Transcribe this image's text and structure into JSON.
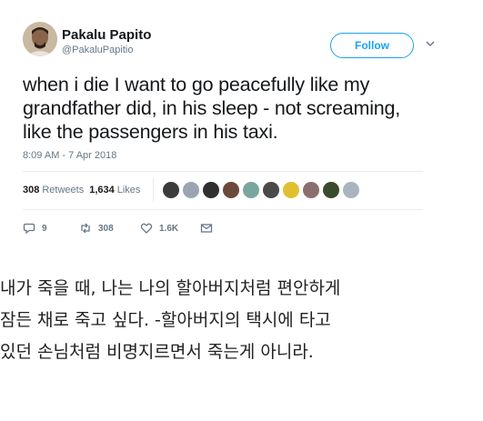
{
  "tweet": {
    "display_name": "Pakalu Papito",
    "handle": "@PakaluPapitio",
    "follow_label": "Follow",
    "text": "when i die I want to go peacefully like my grandfather did, in his sleep - not screaming, like the passengers in his taxi.",
    "timestamp": "8:09 AM - 7 Apr 2018",
    "retweets_count": "308",
    "retweets_label": "Retweets",
    "likes_count": "1,634",
    "likes_label": "Likes",
    "actions": {
      "reply_count": "9",
      "retweet_count": "308",
      "like_count": "1.6K"
    },
    "accent_color": "#1da1f2"
  },
  "caption": {
    "lines": [
      "내가 죽을 때, 나는 나의 할아버지처럼 편안하게",
      "잠든 채로 죽고 싶다. -할아버지의 택시에 타고",
      "있던 손님처럼 비명지르면서 죽는게 아니라."
    ]
  }
}
